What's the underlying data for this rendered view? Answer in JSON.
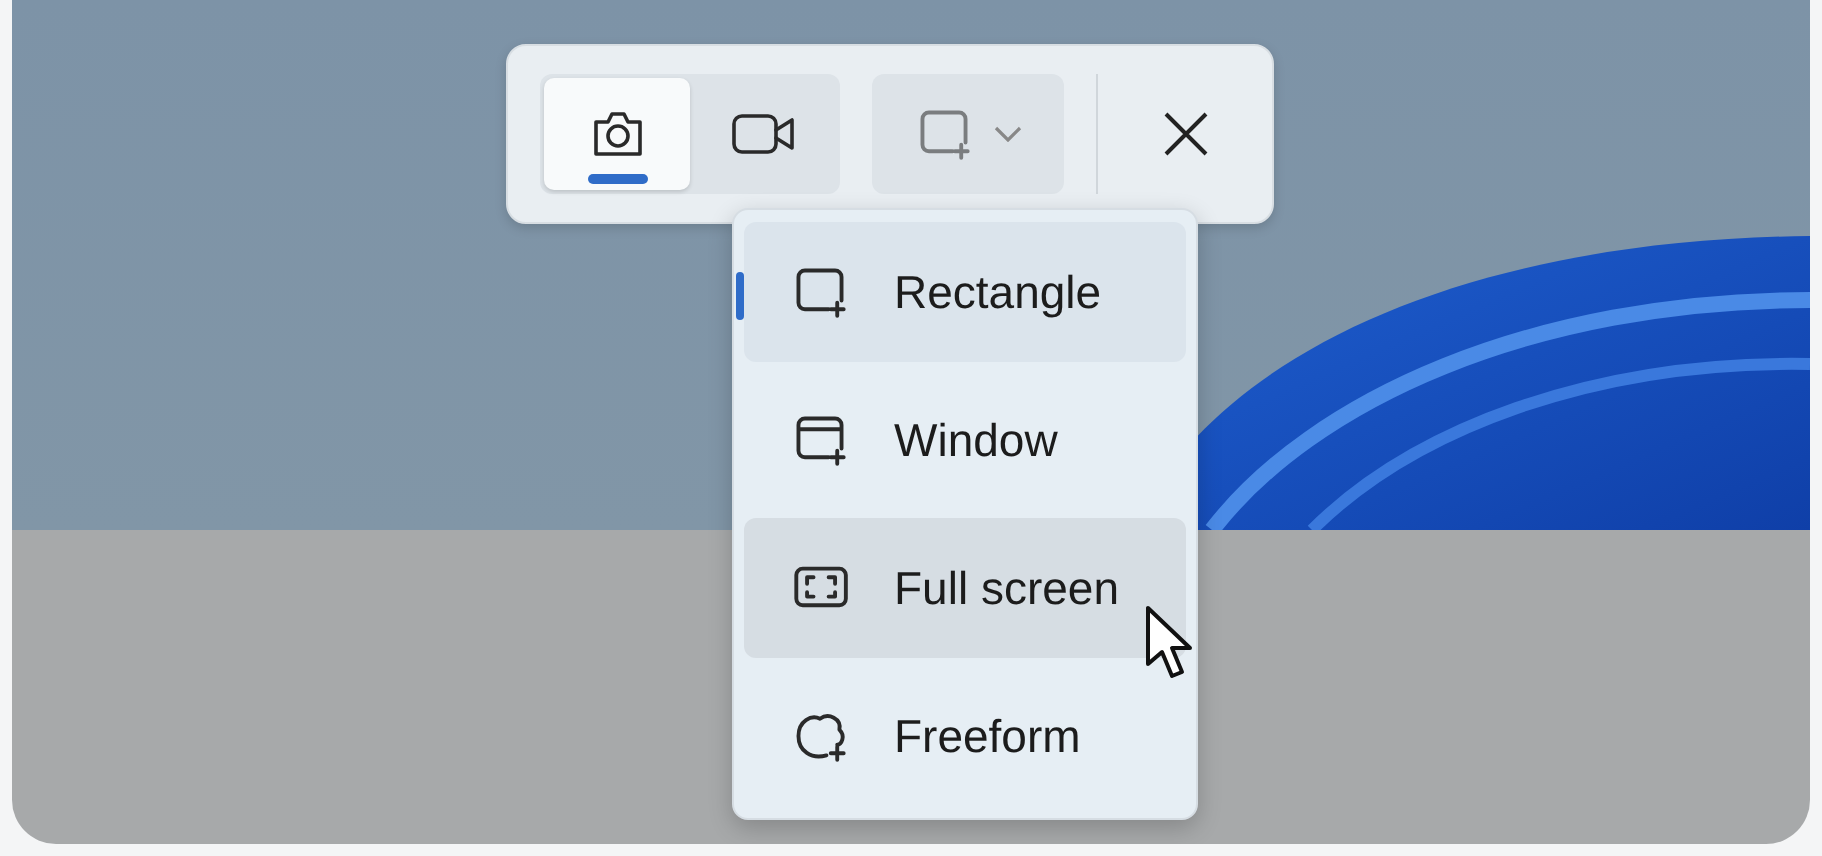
{
  "capture_modes": [
    {
      "kind": "photo",
      "selected": true
    },
    {
      "kind": "video",
      "selected": false
    }
  ],
  "shape_dropdown": {
    "kind": "rectangle"
  },
  "shape_menu": [
    {
      "kind": "rectangle",
      "label": "Rectangle",
      "selected": true,
      "hovered": false
    },
    {
      "kind": "window",
      "label": "Window",
      "selected": false,
      "hovered": false
    },
    {
      "kind": "fullscreen",
      "label": "Full screen",
      "selected": false,
      "hovered": true
    },
    {
      "kind": "freeform",
      "label": "Freeform",
      "selected": false,
      "hovered": false
    }
  ]
}
